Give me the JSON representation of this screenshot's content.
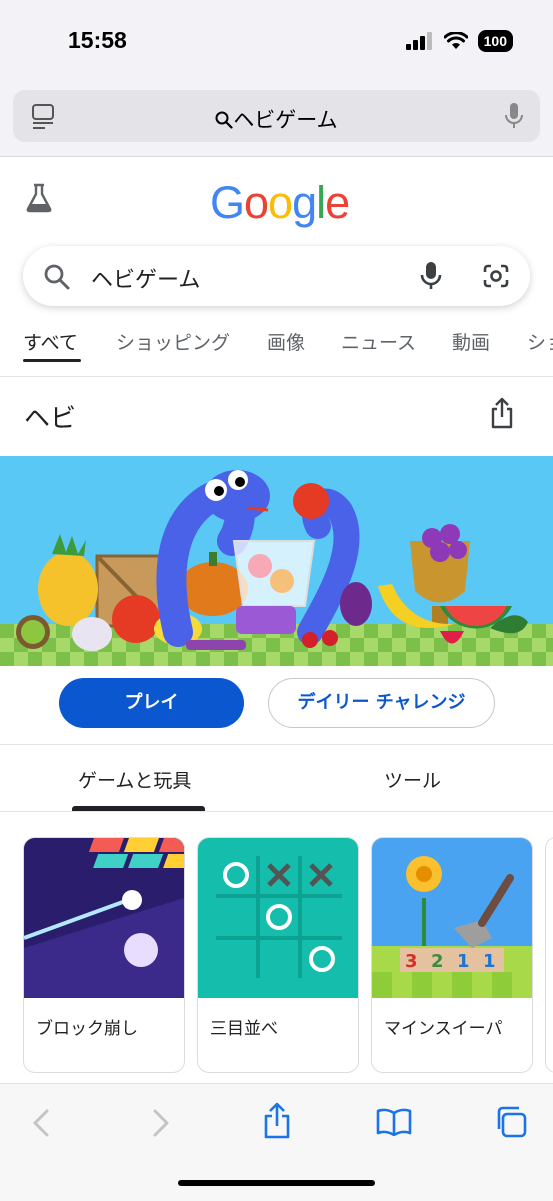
{
  "status": {
    "time": "15:58",
    "battery": "100"
  },
  "browser": {
    "url_text": "ヘビゲーム"
  },
  "google": {
    "logo_letters": [
      {
        "ch": "G",
        "color": "#4285F4"
      },
      {
        "ch": "o",
        "color": "#EA4335"
      },
      {
        "ch": "o",
        "color": "#FBBC05"
      },
      {
        "ch": "g",
        "color": "#4285F4"
      },
      {
        "ch": "l",
        "color": "#34A853"
      },
      {
        "ch": "e",
        "color": "#EA4335"
      }
    ],
    "search_value": "ヘビゲーム"
  },
  "nav": {
    "items": [
      "すべて",
      "ショッピング",
      "画像",
      "ニュース",
      "動画",
      "ショ"
    ]
  },
  "snake": {
    "title": "ヘビ",
    "play_label": "プレイ",
    "daily_label": "デイリー チャレンジ"
  },
  "game_tabs": [
    "ゲームと玩具",
    "ツール"
  ],
  "cards": [
    {
      "label": "ブロック崩し"
    },
    {
      "label": "三目並べ"
    },
    {
      "label": "マインスイーパ"
    }
  ],
  "minesweeper_digits": [
    "3",
    "2",
    "1",
    "1"
  ],
  "colors": {
    "accent_blue": "#0b57d0",
    "banner_sky": "#5ac8f5"
  }
}
